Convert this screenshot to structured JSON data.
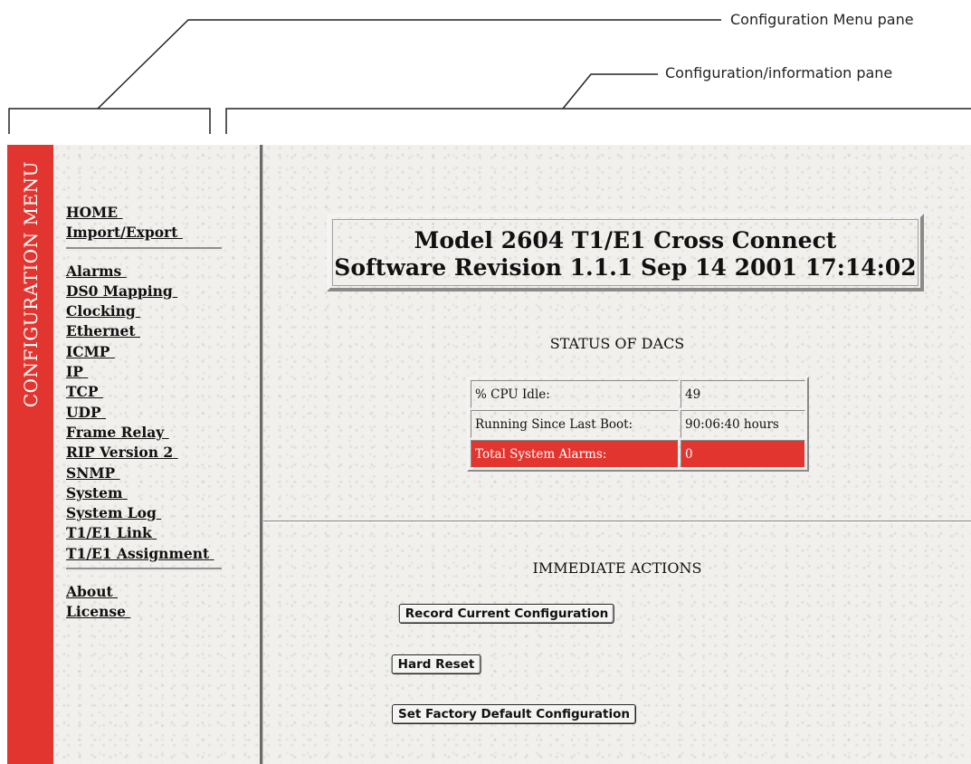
{
  "callouts": {
    "menu_pane": "Configuration Menu pane",
    "info_pane": "Configuration/information pane"
  },
  "menu": {
    "strip_title": "CONFIGURATION MENU",
    "groups": [
      [
        "HOME",
        "Import/Export"
      ],
      [
        "Alarms",
        "DS0 Mapping",
        "Clocking",
        "Ethernet",
        "ICMP",
        "IP",
        "TCP",
        "UDP",
        "Frame Relay",
        "RIP Version 2",
        "SNMP",
        "System",
        "System Log",
        "T1/E1 Link",
        "T1/E1 Assignment"
      ],
      [
        "About",
        "License"
      ]
    ]
  },
  "banner": {
    "line1": "Model 2604 T1/E1 Cross Connect",
    "line2": "Software Revision 1.1.1 Sep 14 2001 17:14:02"
  },
  "status": {
    "title": "STATUS OF DACS",
    "rows": [
      {
        "label": "% CPU Idle:",
        "value": "49"
      },
      {
        "label": "Running Since Last Boot:",
        "value": "90:06:40 hours"
      },
      {
        "label": "Total System Alarms:",
        "value": "0"
      }
    ]
  },
  "actions": {
    "title": "IMMEDIATE ACTIONS",
    "record_label": "Record Current Configuration",
    "hard_reset_label": "Hard Reset",
    "factory_label": "Set Factory Default Configuration"
  },
  "colors": {
    "menu_red": "#e3352f",
    "alarm_red": "#e3352f",
    "background": "#f1f0ed"
  }
}
